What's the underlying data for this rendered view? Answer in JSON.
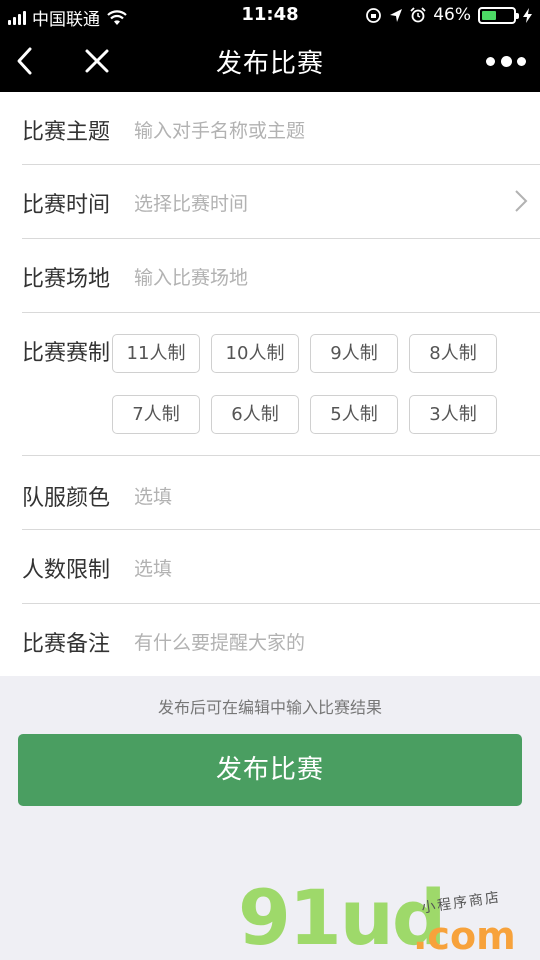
{
  "status_bar": {
    "carrier": "中国联通",
    "time": "11:48",
    "battery_percent": "46%",
    "battery_level": 0.46
  },
  "nav": {
    "title": "发布比赛",
    "back_icon": "chevron-left-icon",
    "close_icon": "close-icon",
    "more_icon": "more-dots-icon"
  },
  "form": {
    "topic": {
      "label": "比赛主题",
      "placeholder": "输入对手名称或主题"
    },
    "time": {
      "label": "比赛时间",
      "placeholder": "选择比赛时间"
    },
    "venue": {
      "label": "比赛场地",
      "placeholder": "输入比赛场地"
    },
    "format": {
      "label": "比赛赛制",
      "options": [
        "11人制",
        "10人制",
        "9人制",
        "8人制",
        "7人制",
        "6人制",
        "5人制",
        "3人制"
      ]
    },
    "jersey_color": {
      "label": "队服颜色",
      "placeholder": "选填"
    },
    "player_limit": {
      "label": "人数限制",
      "placeholder": "选填"
    },
    "notes": {
      "label": "比赛备注",
      "placeholder": "有什么要提醒大家的"
    }
  },
  "hint": "发布后可在编辑中输入比赛结果",
  "publish_button": "发布比赛",
  "watermark": {
    "brand": "91ud",
    "domain": ".com",
    "tagline": "小程序商店"
  },
  "colors": {
    "accent": "#4a9e61",
    "placeholder": "#b2b2b2",
    "nav_bg": "#000000"
  }
}
